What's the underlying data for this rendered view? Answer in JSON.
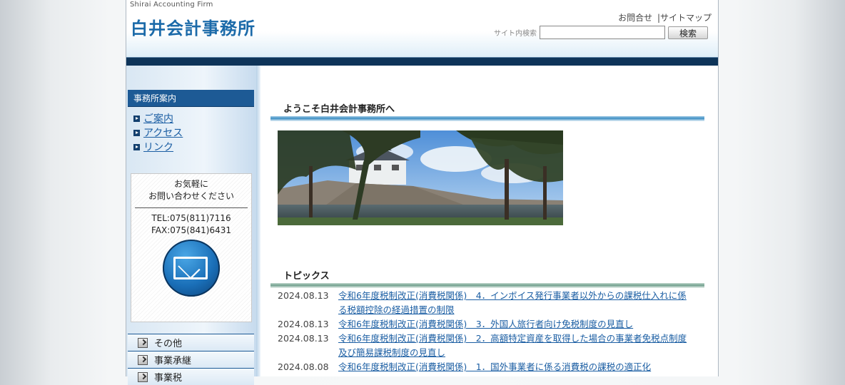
{
  "header": {
    "firm_en": "Shirai Accounting Firm",
    "firm_jp": "白井会計事務所",
    "link_contact": "お問合せ",
    "link_sep": "|",
    "link_sitemap": "サイトマップ",
    "search_label": "サイト内検索",
    "search_value": "",
    "search_button": "検索"
  },
  "sidebar": {
    "heading": "事務所案内",
    "links": [
      {
        "label": "ご案内"
      },
      {
        "label": "アクセス"
      },
      {
        "label": "リンク"
      }
    ],
    "contact": {
      "message_line1": "お気軽に",
      "message_line2": "お問い合わせください",
      "tel": "TEL:075(811)7116",
      "fax": "FAX:075(841)6431"
    },
    "menu": [
      {
        "label": "その他"
      },
      {
        "label": "事業承継"
      },
      {
        "label": "事業税"
      }
    ]
  },
  "main": {
    "welcome_heading": "ようこそ白井会計事務所へ",
    "topics_heading": "トピックス",
    "topics": [
      {
        "date": "2024.08.13",
        "title": "令和6年度税制改正(消費税関係)　4．インボイス発行事業者以外からの課税仕入れに係る税額控除の経過措置の制限"
      },
      {
        "date": "2024.08.13",
        "title": "令和6年度税制改正(消費税関係)　3．外国人旅行者向け免税制度の見直し"
      },
      {
        "date": "2024.08.13",
        "title": "令和6年度税制改正(消費税関係)　2．高額特定資産を取得した場合の事業者免税点制度及び簡易課税制度の見直し"
      },
      {
        "date": "2024.08.08",
        "title": "令和6年度税制改正(消費税関係)　1．国外事業者に係る消費税の課税の適正化"
      }
    ]
  },
  "colors": {
    "brand_blue": "#1b6aa9",
    "nav_dark": "#0e3459",
    "sidebar_head": "#1d5a95",
    "link": "#1b5ea3"
  }
}
